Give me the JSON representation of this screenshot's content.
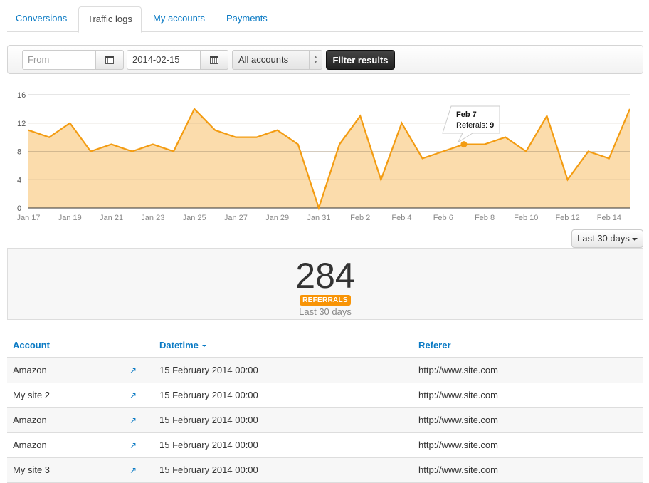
{
  "tabs": [
    {
      "label": "Conversions",
      "active": false
    },
    {
      "label": "Traffic logs",
      "active": true
    },
    {
      "label": "My accounts",
      "active": false
    },
    {
      "label": "Payments",
      "active": false
    }
  ],
  "filters": {
    "from_placeholder": "From",
    "from_value": "",
    "to_value": "2014-02-15",
    "account_select": "All accounts",
    "filter_button": "Filter results",
    "calendar_icon": "calendar-icon"
  },
  "chart_data": {
    "type": "area",
    "title": "",
    "xlabel": "",
    "ylabel": "",
    "ylim": [
      0,
      16
    ],
    "yticks": [
      0,
      4,
      8,
      12,
      16
    ],
    "grid": true,
    "x": [
      "Jan 17",
      "Jan 18",
      "Jan 19",
      "Jan 20",
      "Jan 21",
      "Jan 22",
      "Jan 23",
      "Jan 24",
      "Jan 25",
      "Jan 26",
      "Jan 27",
      "Jan 28",
      "Jan 29",
      "Jan 30",
      "Jan 31",
      "Feb 1",
      "Feb 2",
      "Feb 3",
      "Feb 4",
      "Feb 5",
      "Feb 6",
      "Feb 7",
      "Feb 8",
      "Feb 9",
      "Feb 10",
      "Feb 11",
      "Feb 12",
      "Feb 13",
      "Feb 14",
      "Feb 15"
    ],
    "xtick_labels": [
      "Jan 17",
      "Jan 19",
      "Jan 21",
      "Jan 23",
      "Jan 25",
      "Jan 27",
      "Jan 29",
      "Jan 31",
      "Feb 2",
      "Feb 4",
      "Feb 6",
      "Feb 8",
      "Feb 10",
      "Feb 12",
      "Feb 14"
    ],
    "series": [
      {
        "name": "Referals",
        "values": [
          11,
          10,
          12,
          8,
          9,
          8,
          9,
          8,
          14,
          11,
          10,
          10,
          11,
          9,
          0,
          9,
          13,
          4,
          12,
          7,
          8,
          9,
          9,
          10,
          8,
          13,
          4,
          8,
          7,
          14
        ]
      }
    ],
    "colors": {
      "line": "#f39c12",
      "fill": "#fbdcac"
    },
    "tooltip": {
      "index": 21,
      "title": "Feb 7",
      "label": "Referals: ",
      "value": "9"
    }
  },
  "range_button": "Last 30 days",
  "summary": {
    "count": "284",
    "badge": "REFERRALS",
    "period": "Last 30 days"
  },
  "table": {
    "headers": {
      "account": "Account",
      "datetime": "Datetime",
      "referer": "Referer"
    },
    "rows": [
      {
        "account": "Amazon",
        "datetime": "15 February 2014 00:00",
        "referer": "http://www.site.com"
      },
      {
        "account": "My site 2",
        "datetime": "15 February 2014 00:00",
        "referer": "http://www.site.com"
      },
      {
        "account": "Amazon",
        "datetime": "15 February 2014 00:00",
        "referer": "http://www.site.com"
      },
      {
        "account": "Amazon",
        "datetime": "15 February 2014 00:00",
        "referer": "http://www.site.com"
      },
      {
        "account": "My site 3",
        "datetime": "15 February 2014 00:00",
        "referer": "http://www.site.com"
      }
    ]
  }
}
